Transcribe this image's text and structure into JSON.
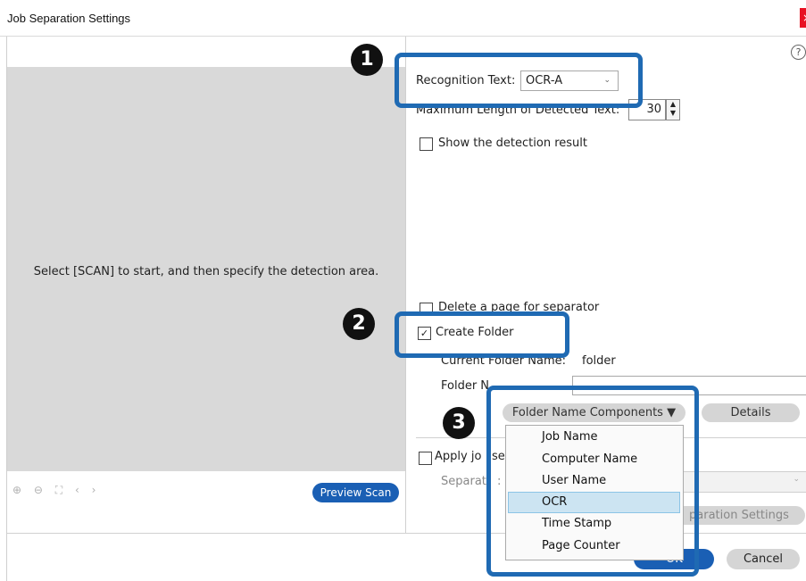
{
  "window": {
    "title": "Job Separation Settings",
    "close_glyph": "×"
  },
  "preview": {
    "message": "Select [SCAN] to start, and then specify the detection area.",
    "zoom_icons": "⊕ ⊖ ⛶ ‹ ›",
    "preview_button": "Preview Scan"
  },
  "help": {
    "glyph": "?"
  },
  "recognition": {
    "label": "Recognition Text:",
    "value": "OCR-A"
  },
  "max_length": {
    "label": "Maximum Length of Detected Text:",
    "value": "30"
  },
  "show_detection": {
    "label": "Show the detection result",
    "checked": false
  },
  "delete_page": {
    "label": "Delete a page for separator",
    "checked": false
  },
  "create_folder": {
    "label": "Create Folder",
    "checked": true
  },
  "current_folder": {
    "label": "Current Folder Name:",
    "value": "folder"
  },
  "folder_name": {
    "label": "Folder N"
  },
  "components_button": "Folder Name Components ▼",
  "details_button": "Details",
  "apply": {
    "label_start": "Apply jo",
    "label_cut": "se"
  },
  "separator": {
    "label_start": "Separat",
    "label_end": ":"
  },
  "separation_settings_button": "paration Settings",
  "menu_items": [
    "Job Name",
    "Computer Name",
    "User Name",
    "OCR",
    "Time Stamp",
    "Page Counter"
  ],
  "ok_button": "OK",
  "cancel_button": "Cancel",
  "callouts": [
    "1",
    "2",
    "3"
  ],
  "colors": {
    "accent": "#1f6ab3",
    "button_blue": "#1a5fb4",
    "highlight": "#cce4f2"
  }
}
